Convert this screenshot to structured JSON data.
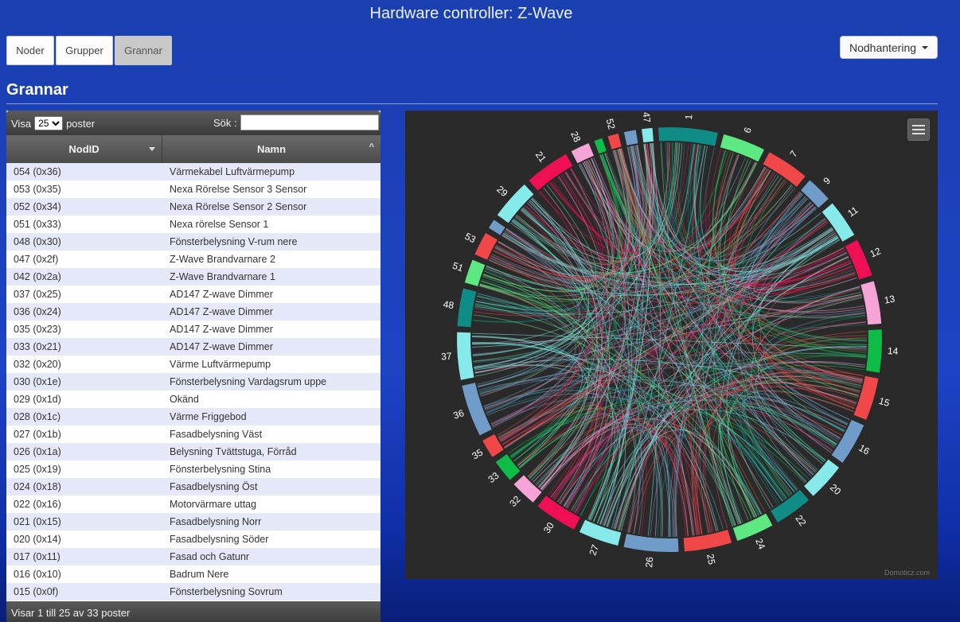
{
  "header": {
    "title": "Hardware controller: Z-Wave"
  },
  "tabs": [
    {
      "label": "Noder"
    },
    {
      "label": "Grupper"
    },
    {
      "label": "Grannar"
    }
  ],
  "actions": {
    "node_menu_label": "Nodhantering"
  },
  "section": {
    "title": "Grannar"
  },
  "table": {
    "show_label": "Visa",
    "page_size": "25",
    "records_label": "poster",
    "search_label": "Sök :",
    "search_value": "",
    "columns": [
      "NodID",
      "Namn"
    ],
    "rows": [
      [
        "054 (0x36)",
        "Värmekabel Luftvärmepump"
      ],
      [
        "053 (0x35)",
        "Nexa Rörelse Sensor 3 Sensor"
      ],
      [
        "052 (0x34)",
        "Nexa Rörelse Sensor 2 Sensor"
      ],
      [
        "051 (0x33)",
        "Nexa rörelse Sensor 1"
      ],
      [
        "048 (0x30)",
        "Fönsterbelysning V-rum nere"
      ],
      [
        "047 (0x2f)",
        "Z-Wave Brandvarnare 2"
      ],
      [
        "042 (0x2a)",
        "Z-Wave Brandvarnare 1"
      ],
      [
        "037 (0x25)",
        "AD147 Z-wave Dimmer"
      ],
      [
        "036 (0x24)",
        "AD147 Z-wave Dimmer"
      ],
      [
        "035 (0x23)",
        "AD147 Z-wave Dimmer"
      ],
      [
        "033 (0x21)",
        "AD147 Z-wave Dimmer"
      ],
      [
        "032 (0x20)",
        "Värme Luftvärmepump"
      ],
      [
        "030 (0x1e)",
        "Fönsterbelysning Vardagsrum uppe"
      ],
      [
        "029 (0x1d)",
        "Okänd"
      ],
      [
        "028 (0x1c)",
        "Värme Friggebod"
      ],
      [
        "027 (0x1b)",
        "Fasadbelysning Väst"
      ],
      [
        "026 (0x1a)",
        "Belysning Tvättstuga, Förråd"
      ],
      [
        "025 (0x19)",
        "Fönsterbelysning Stina"
      ],
      [
        "024 (0x18)",
        "Fasadbelysning Öst"
      ],
      [
        "022 (0x16)",
        "Motorvärmare uttag"
      ],
      [
        "021 (0x15)",
        "Fasadbelysning Norr"
      ],
      [
        "020 (0x14)",
        "Fasadbelysning Söder"
      ],
      [
        "017 (0x11)",
        "Fasad och Gatunr"
      ],
      [
        "016 (0x10)",
        "Badrum Nere"
      ],
      [
        "015 (0x0f)",
        "Fönsterbelysning Sovrum"
      ]
    ],
    "footer": "Visar 1 till 25 av 33 poster"
  },
  "chart": {
    "credit": "Domoticz.com",
    "nodes": [
      {
        "label": "1",
        "color": "#0f8c86",
        "w": 5.0
      },
      {
        "label": "6",
        "color": "#5ee882",
        "w": 3.6
      },
      {
        "label": "7",
        "color": "#f04848",
        "w": 3.6
      },
      {
        "label": "9",
        "color": "#6f9cc8",
        "w": 2.2
      },
      {
        "label": "11",
        "color": "#86eaea",
        "w": 3.2
      },
      {
        "label": "12",
        "color": "#ee0f55",
        "w": 3.2
      },
      {
        "label": "13",
        "color": "#f6a3d8",
        "w": 3.6
      },
      {
        "label": "14",
        "color": "#0ebc48",
        "w": 3.6
      },
      {
        "label": "15",
        "color": "#f04848",
        "w": 3.6
      },
      {
        "label": "16",
        "color": "#6f9cc8",
        "w": 3.6
      },
      {
        "label": "20",
        "color": "#86eaea",
        "w": 3.2
      },
      {
        "label": "22",
        "color": "#0f8c86",
        "w": 3.2
      },
      {
        "label": "24",
        "color": "#5ee882",
        "w": 3.2
      },
      {
        "label": "25",
        "color": "#f04848",
        "w": 4.0
      },
      {
        "label": "26",
        "color": "#6f9cc8",
        "w": 4.6
      },
      {
        "label": "27",
        "color": "#86eaea",
        "w": 3.4
      },
      {
        "label": "30",
        "color": "#ee0f55",
        "w": 3.6
      },
      {
        "label": "32",
        "color": "#f6a3d8",
        "w": 2.2
      },
      {
        "label": "33",
        "color": "#0ebc48",
        "w": 1.9
      },
      {
        "label": "35",
        "color": "#f04848",
        "w": 1.6
      },
      {
        "label": "36",
        "color": "#6f9cc8",
        "w": 4.4
      },
      {
        "label": "37",
        "color": "#86eaea",
        "w": 4.0
      },
      {
        "label": "48",
        "color": "#0f8c86",
        "w": 3.2
      },
      {
        "label": "51",
        "color": "#5ee882",
        "w": 2.0
      },
      {
        "label": "53",
        "color": "#f04848",
        "w": 2.0
      },
      {
        "label": "",
        "color": "#6f9cc8",
        "w": 0.8
      },
      {
        "label": "29",
        "color": "#86eaea",
        "w": 3.4
      },
      {
        "label": "21",
        "color": "#ee0f55",
        "w": 3.8
      },
      {
        "label": "28",
        "color": "#f6a3d8",
        "w": 1.6
      },
      {
        "label": "",
        "color": "#0ebc48",
        "w": 0.7
      },
      {
        "label": "52",
        "color": "#f04848",
        "w": 0.9
      },
      {
        "label": "",
        "color": "#6f9cc8",
        "w": 1.0
      },
      {
        "label": "47",
        "color": "#86eaea",
        "w": 0.9
      }
    ]
  }
}
